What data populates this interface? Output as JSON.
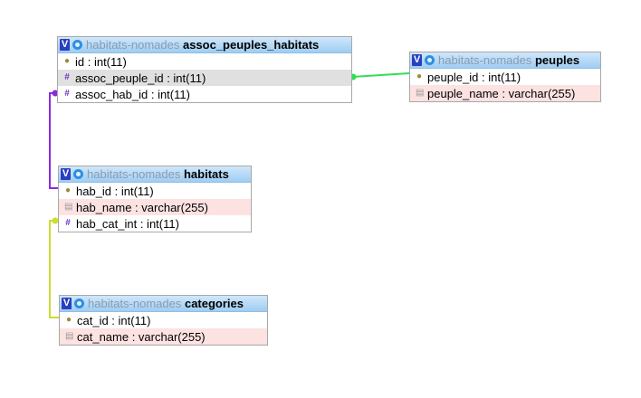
{
  "tables": {
    "assoc": {
      "db": "habitats-nomades",
      "name": "assoc_peuples_habitats",
      "columns": [
        {
          "label": "id : int(11)",
          "icon": "key-icon"
        },
        {
          "label": "assoc_peuple_id : int(11)",
          "icon": "hash-icon"
        },
        {
          "label": "assoc_hab_id : int(11)",
          "icon": "hash-icon"
        }
      ]
    },
    "peuples": {
      "db": "habitats-nomades",
      "name": "peuples",
      "columns": [
        {
          "label": "peuple_id : int(11)",
          "icon": "key-icon"
        },
        {
          "label": "peuple_name : varchar(255)",
          "icon": "text-field-icon"
        }
      ]
    },
    "habitats": {
      "db": "habitats-nomades",
      "name": "habitats",
      "columns": [
        {
          "label": "hab_id : int(11)",
          "icon": "key-icon"
        },
        {
          "label": "hab_name : varchar(255)",
          "icon": "text-field-icon"
        },
        {
          "label": "hab_cat_int : int(11)",
          "icon": "hash-icon"
        }
      ]
    },
    "categories": {
      "db": "habitats-nomades",
      "name": "categories",
      "columns": [
        {
          "label": "cat_id : int(11)",
          "icon": "key-icon"
        },
        {
          "label": "cat_name : varchar(255)",
          "icon": "text-field-icon"
        }
      ]
    }
  },
  "header_button_label": "V",
  "relation_colors": {
    "assoc_to_peuples": "#33dd55",
    "assoc_to_habitats": "#8a2be2",
    "habitats_to_categories": "#ccdd33"
  }
}
